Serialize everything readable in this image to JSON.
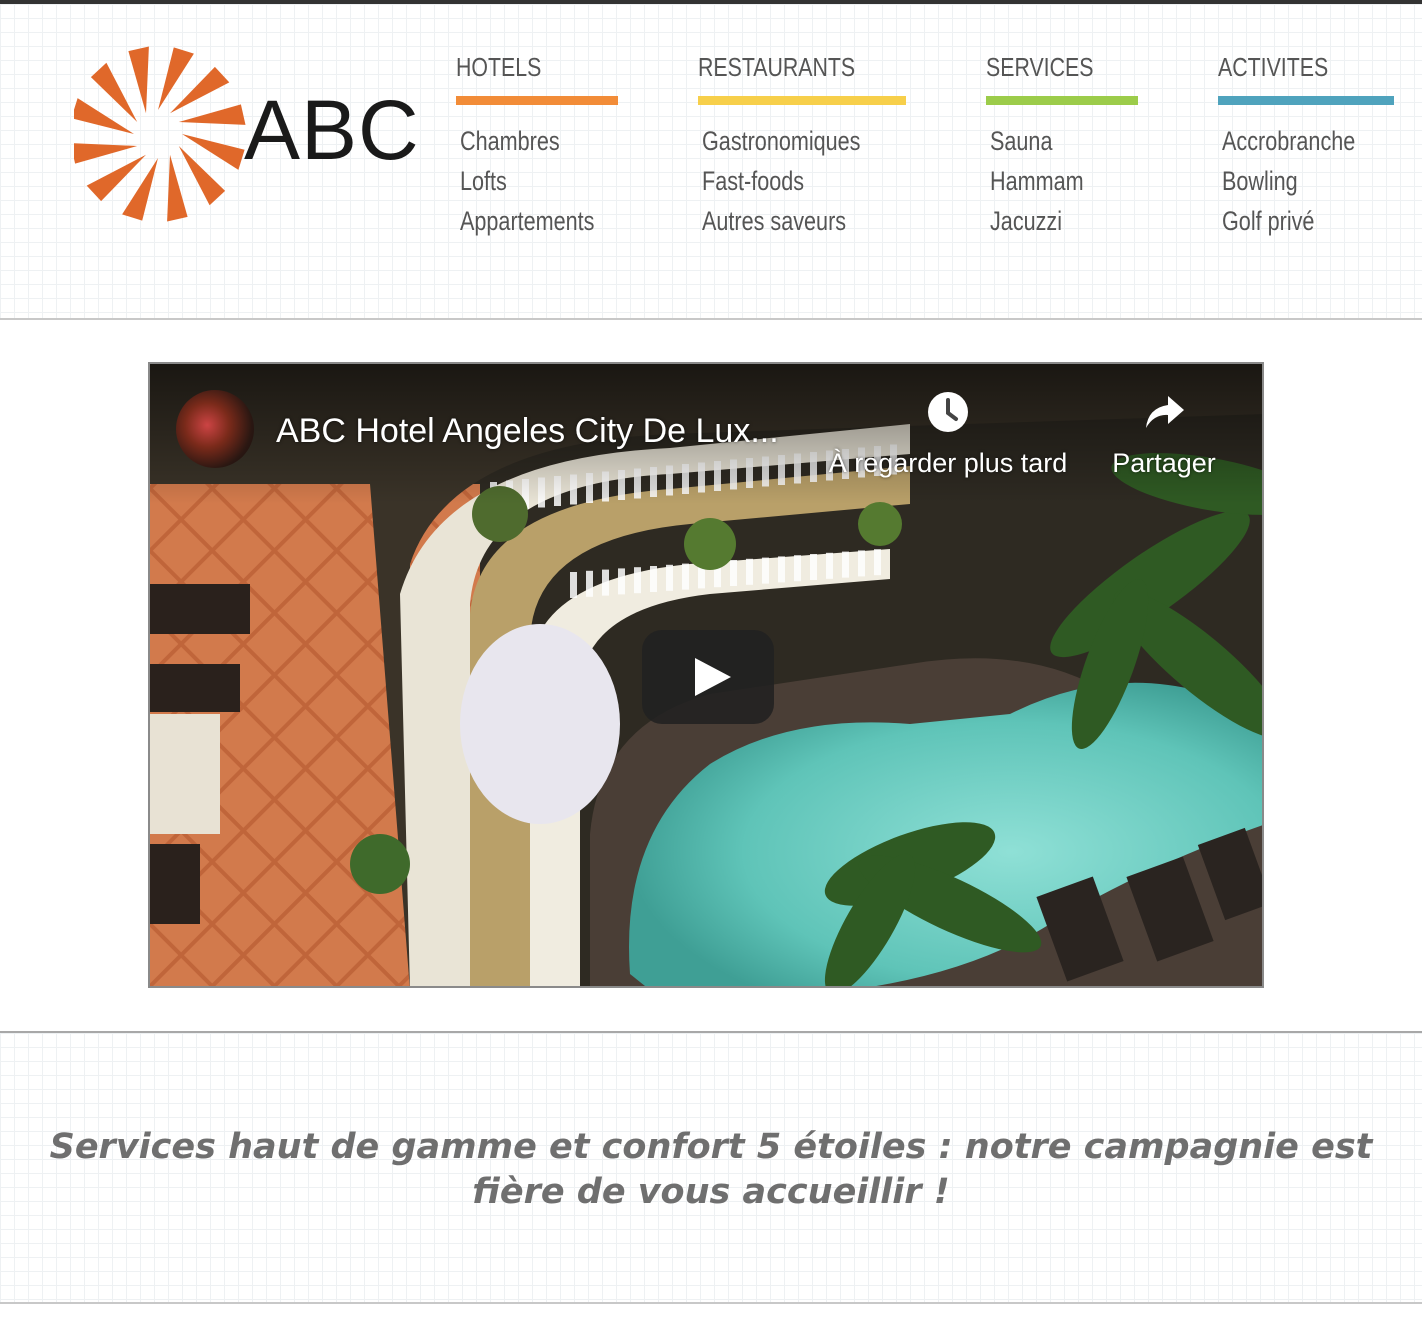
{
  "brand": {
    "logo_text": "ABC",
    "accent": "#e0682a"
  },
  "nav": {
    "columns": [
      {
        "title": "HOTELS",
        "color": "#f28c38",
        "items": [
          "Chambres",
          "Lofts",
          "Appartements"
        ]
      },
      {
        "title": "RESTAURANTS",
        "color": "#f7cf4a",
        "items": [
          "Gastronomiques",
          "Fast-foods",
          "Autres saveurs"
        ]
      },
      {
        "title": "SERVICES",
        "color": "#9ccc4a",
        "items": [
          "Sauna",
          "Hammam",
          "Jacuzzi"
        ]
      },
      {
        "title": "ACTIVITES",
        "color": "#4fa3bd",
        "items": [
          "Accrobranche",
          "Bowling",
          "Golf privé"
        ]
      }
    ]
  },
  "video": {
    "title": "ABC Hotel Angeles City De Lux...",
    "watch_later_label": "À regarder plus tard",
    "share_label": "Partager",
    "icons": {
      "watch_later": "clock-icon",
      "share": "share-arrow-icon",
      "play": "play-icon"
    }
  },
  "tagline": "Services haut de gamme et confort 5 étoiles : notre campagnie est fière de vous accueillir !"
}
